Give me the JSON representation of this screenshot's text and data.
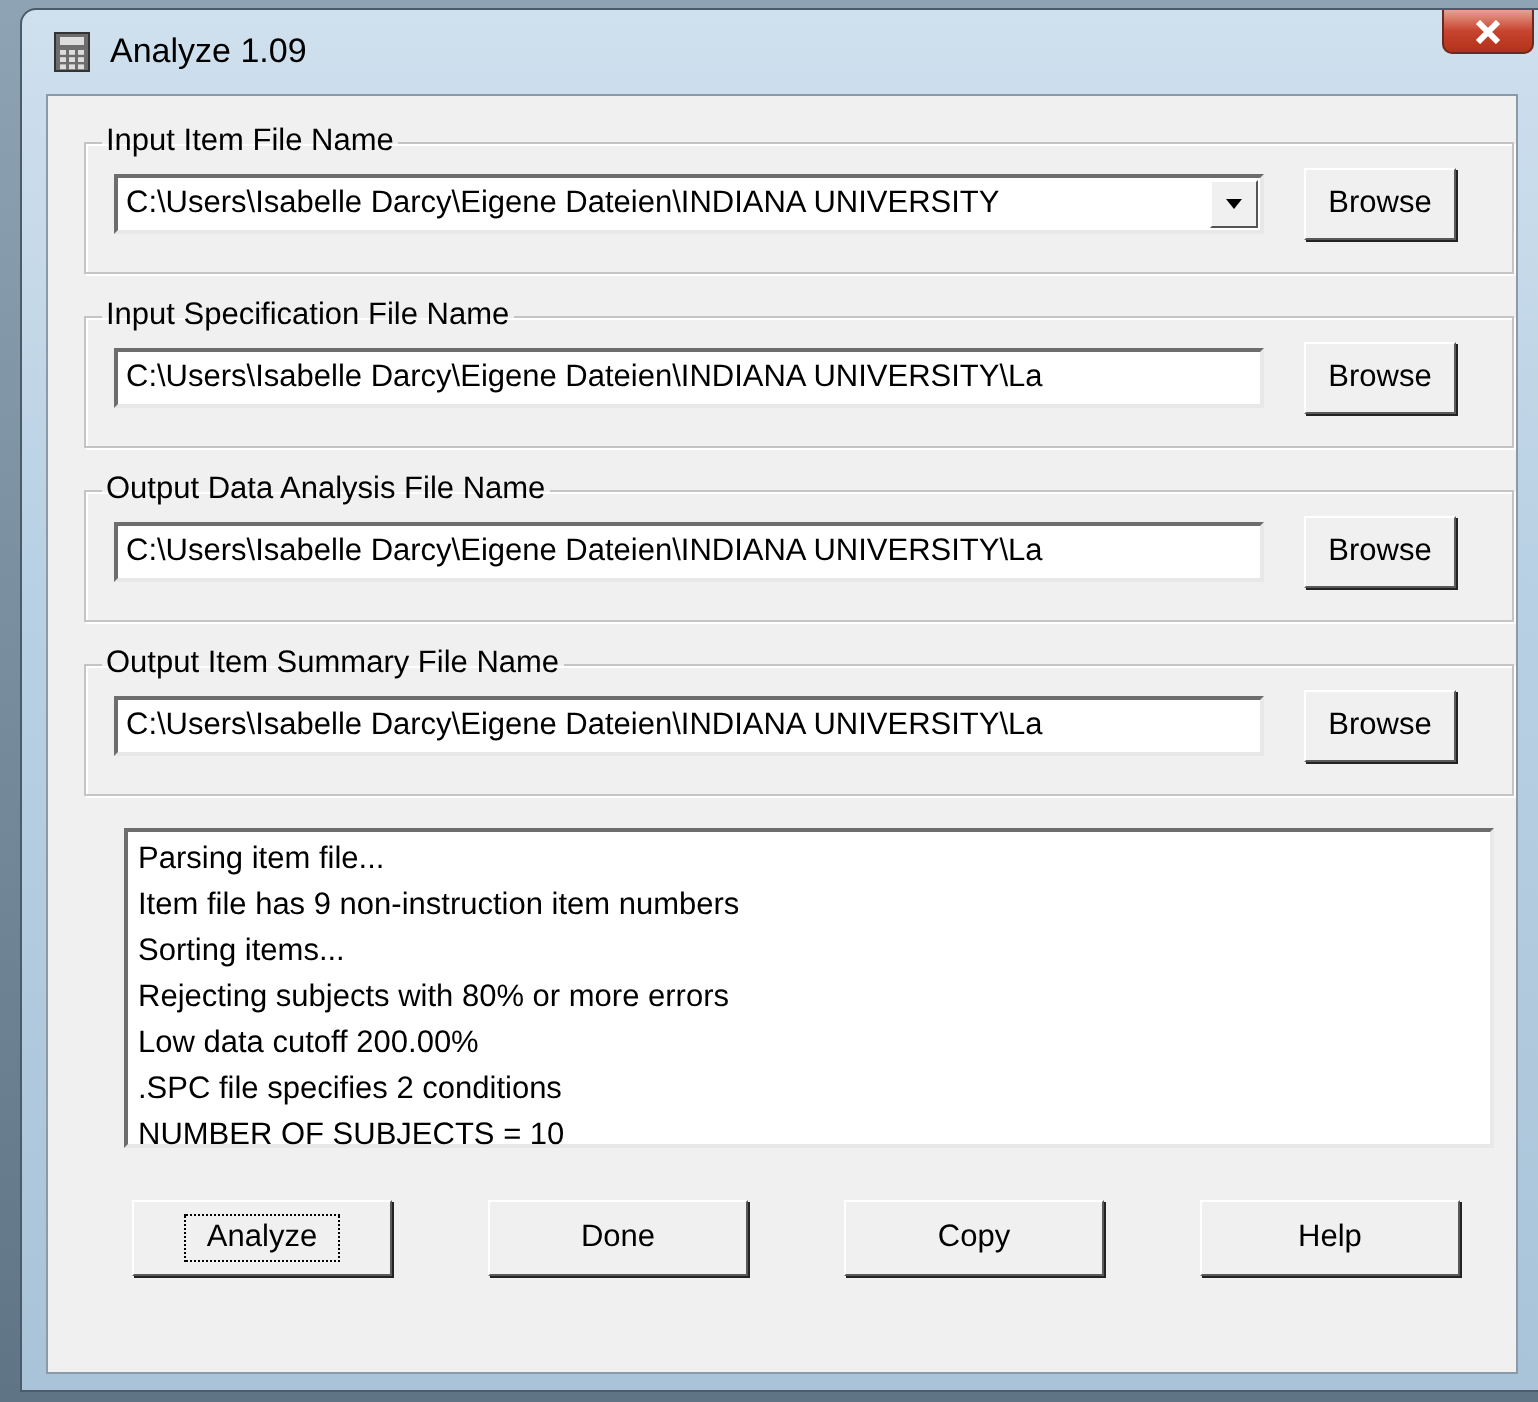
{
  "window": {
    "title": "Analyze 1.09"
  },
  "file_groups": [
    {
      "label": "Input Item File Name",
      "kind": "combo",
      "value": "C:\\Users\\Isabelle Darcy\\Eigene Dateien\\INDIANA UNIVERSITY",
      "button": "Browse"
    },
    {
      "label": "Input Specification File Name",
      "kind": "text",
      "value": "C:\\Users\\Isabelle Darcy\\Eigene Dateien\\INDIANA UNIVERSITY\\La",
      "button": "Browse"
    },
    {
      "label": "Output Data Analysis File Name",
      "kind": "text",
      "value": "C:\\Users\\Isabelle Darcy\\Eigene Dateien\\INDIANA UNIVERSITY\\La",
      "button": "Browse"
    },
    {
      "label": "Output Item Summary File Name",
      "kind": "text",
      "value": "C:\\Users\\Isabelle Darcy\\Eigene Dateien\\INDIANA UNIVERSITY\\La",
      "button": "Browse"
    }
  ],
  "log": [
    "Parsing item file...",
    "Item file has 9 non-instruction item numbers",
    "Sorting items...",
    "Rejecting subjects with 80% or more errors",
    "Low data cutoff 200.00%",
    ".SPC file specifies 2 conditions",
    "NUMBER OF SUBJECTS = 10"
  ],
  "buttons": [
    {
      "label": "Analyze",
      "focused": true
    },
    {
      "label": "Done",
      "focused": false
    },
    {
      "label": "Copy",
      "focused": false
    },
    {
      "label": "Help",
      "focused": false
    }
  ]
}
